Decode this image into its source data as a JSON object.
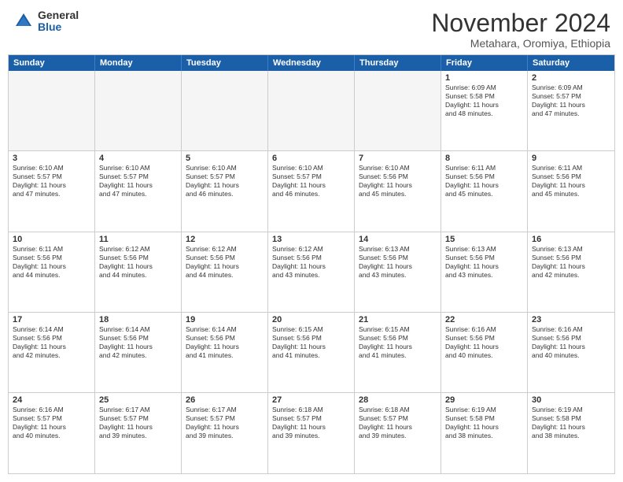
{
  "header": {
    "logo_general": "General",
    "logo_blue": "Blue",
    "month_title": "November 2024",
    "subtitle": "Metahara, Oromiya, Ethiopia"
  },
  "weekdays": [
    "Sunday",
    "Monday",
    "Tuesday",
    "Wednesday",
    "Thursday",
    "Friday",
    "Saturday"
  ],
  "weeks": [
    [
      {
        "day": "",
        "info": "",
        "empty": true
      },
      {
        "day": "",
        "info": "",
        "empty": true
      },
      {
        "day": "",
        "info": "",
        "empty": true
      },
      {
        "day": "",
        "info": "",
        "empty": true
      },
      {
        "day": "",
        "info": "",
        "empty": true
      },
      {
        "day": "1",
        "info": "Sunrise: 6:09 AM\nSunset: 5:58 PM\nDaylight: 11 hours\nand 48 minutes.",
        "empty": false
      },
      {
        "day": "2",
        "info": "Sunrise: 6:09 AM\nSunset: 5:57 PM\nDaylight: 11 hours\nand 47 minutes.",
        "empty": false
      }
    ],
    [
      {
        "day": "3",
        "info": "Sunrise: 6:10 AM\nSunset: 5:57 PM\nDaylight: 11 hours\nand 47 minutes.",
        "empty": false
      },
      {
        "day": "4",
        "info": "Sunrise: 6:10 AM\nSunset: 5:57 PM\nDaylight: 11 hours\nand 47 minutes.",
        "empty": false
      },
      {
        "day": "5",
        "info": "Sunrise: 6:10 AM\nSunset: 5:57 PM\nDaylight: 11 hours\nand 46 minutes.",
        "empty": false
      },
      {
        "day": "6",
        "info": "Sunrise: 6:10 AM\nSunset: 5:57 PM\nDaylight: 11 hours\nand 46 minutes.",
        "empty": false
      },
      {
        "day": "7",
        "info": "Sunrise: 6:10 AM\nSunset: 5:56 PM\nDaylight: 11 hours\nand 45 minutes.",
        "empty": false
      },
      {
        "day": "8",
        "info": "Sunrise: 6:11 AM\nSunset: 5:56 PM\nDaylight: 11 hours\nand 45 minutes.",
        "empty": false
      },
      {
        "day": "9",
        "info": "Sunrise: 6:11 AM\nSunset: 5:56 PM\nDaylight: 11 hours\nand 45 minutes.",
        "empty": false
      }
    ],
    [
      {
        "day": "10",
        "info": "Sunrise: 6:11 AM\nSunset: 5:56 PM\nDaylight: 11 hours\nand 44 minutes.",
        "empty": false
      },
      {
        "day": "11",
        "info": "Sunrise: 6:12 AM\nSunset: 5:56 PM\nDaylight: 11 hours\nand 44 minutes.",
        "empty": false
      },
      {
        "day": "12",
        "info": "Sunrise: 6:12 AM\nSunset: 5:56 PM\nDaylight: 11 hours\nand 44 minutes.",
        "empty": false
      },
      {
        "day": "13",
        "info": "Sunrise: 6:12 AM\nSunset: 5:56 PM\nDaylight: 11 hours\nand 43 minutes.",
        "empty": false
      },
      {
        "day": "14",
        "info": "Sunrise: 6:13 AM\nSunset: 5:56 PM\nDaylight: 11 hours\nand 43 minutes.",
        "empty": false
      },
      {
        "day": "15",
        "info": "Sunrise: 6:13 AM\nSunset: 5:56 PM\nDaylight: 11 hours\nand 43 minutes.",
        "empty": false
      },
      {
        "day": "16",
        "info": "Sunrise: 6:13 AM\nSunset: 5:56 PM\nDaylight: 11 hours\nand 42 minutes.",
        "empty": false
      }
    ],
    [
      {
        "day": "17",
        "info": "Sunrise: 6:14 AM\nSunset: 5:56 PM\nDaylight: 11 hours\nand 42 minutes.",
        "empty": false
      },
      {
        "day": "18",
        "info": "Sunrise: 6:14 AM\nSunset: 5:56 PM\nDaylight: 11 hours\nand 42 minutes.",
        "empty": false
      },
      {
        "day": "19",
        "info": "Sunrise: 6:14 AM\nSunset: 5:56 PM\nDaylight: 11 hours\nand 41 minutes.",
        "empty": false
      },
      {
        "day": "20",
        "info": "Sunrise: 6:15 AM\nSunset: 5:56 PM\nDaylight: 11 hours\nand 41 minutes.",
        "empty": false
      },
      {
        "day": "21",
        "info": "Sunrise: 6:15 AM\nSunset: 5:56 PM\nDaylight: 11 hours\nand 41 minutes.",
        "empty": false
      },
      {
        "day": "22",
        "info": "Sunrise: 6:16 AM\nSunset: 5:56 PM\nDaylight: 11 hours\nand 40 minutes.",
        "empty": false
      },
      {
        "day": "23",
        "info": "Sunrise: 6:16 AM\nSunset: 5:56 PM\nDaylight: 11 hours\nand 40 minutes.",
        "empty": false
      }
    ],
    [
      {
        "day": "24",
        "info": "Sunrise: 6:16 AM\nSunset: 5:57 PM\nDaylight: 11 hours\nand 40 minutes.",
        "empty": false
      },
      {
        "day": "25",
        "info": "Sunrise: 6:17 AM\nSunset: 5:57 PM\nDaylight: 11 hours\nand 39 minutes.",
        "empty": false
      },
      {
        "day": "26",
        "info": "Sunrise: 6:17 AM\nSunset: 5:57 PM\nDaylight: 11 hours\nand 39 minutes.",
        "empty": false
      },
      {
        "day": "27",
        "info": "Sunrise: 6:18 AM\nSunset: 5:57 PM\nDaylight: 11 hours\nand 39 minutes.",
        "empty": false
      },
      {
        "day": "28",
        "info": "Sunrise: 6:18 AM\nSunset: 5:57 PM\nDaylight: 11 hours\nand 39 minutes.",
        "empty": false
      },
      {
        "day": "29",
        "info": "Sunrise: 6:19 AM\nSunset: 5:58 PM\nDaylight: 11 hours\nand 38 minutes.",
        "empty": false
      },
      {
        "day": "30",
        "info": "Sunrise: 6:19 AM\nSunset: 5:58 PM\nDaylight: 11 hours\nand 38 minutes.",
        "empty": false
      }
    ]
  ]
}
